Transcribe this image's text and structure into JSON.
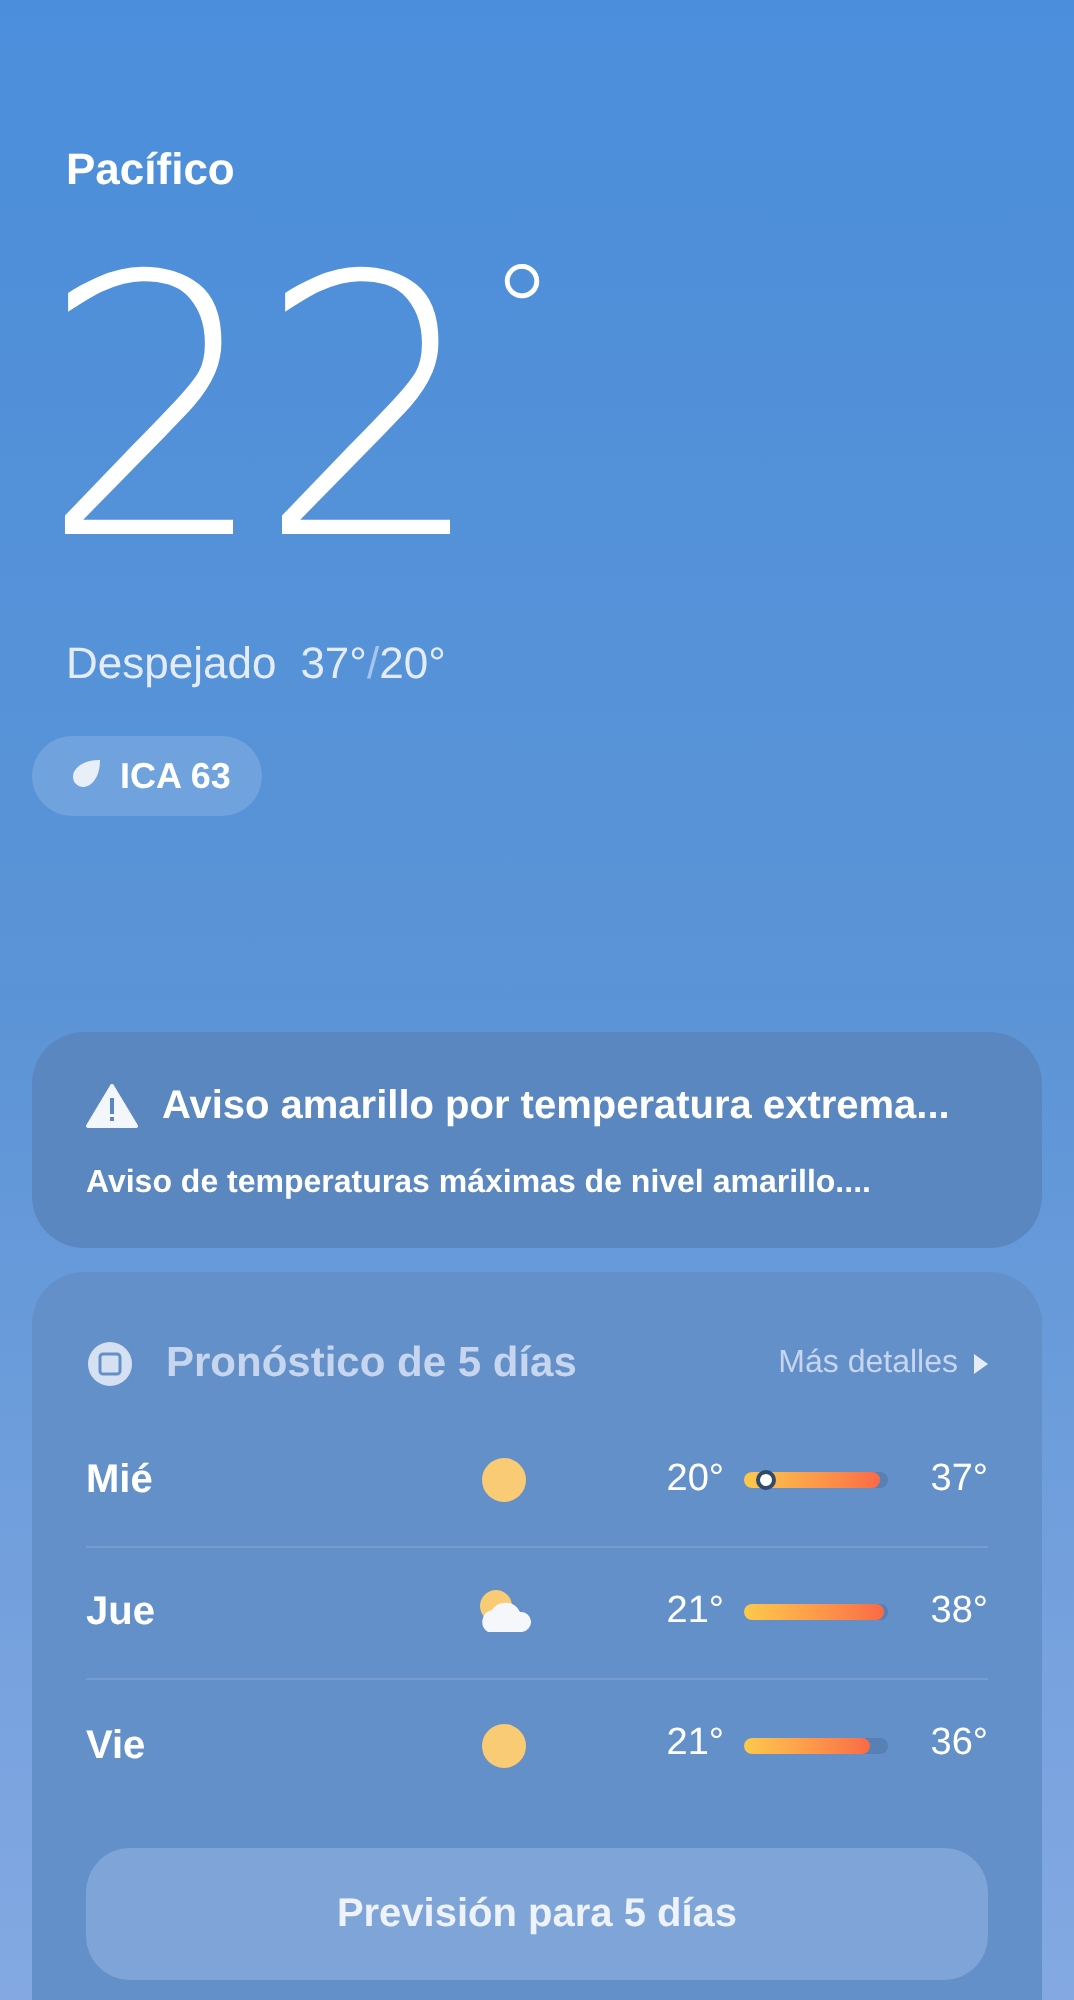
{
  "location": "Pacífico",
  "current": {
    "temperature": "22",
    "unit": "°",
    "condition": "Despejado",
    "high": "37°",
    "separator": "/",
    "low": "20°"
  },
  "aqi": {
    "label": "ICA 63"
  },
  "alert": {
    "title": "Aviso amarillo por temperatura extrema...",
    "text": "Aviso de temperaturas máximas de nivel amarillo...."
  },
  "forecast": {
    "title": "Pronóstico de 5 días",
    "more": "Más detalles",
    "button": "Previsión para 5 días",
    "days": [
      {
        "day": "Mié",
        "kind": "sun",
        "low": "20°",
        "high": "37°",
        "level": 0.95,
        "now": true
      },
      {
        "day": "Jue",
        "kind": "partly-cloudy",
        "low": "21°",
        "high": "38°",
        "level": 0.97,
        "now": false
      },
      {
        "day": "Vie",
        "kind": "sun",
        "low": "21°",
        "high": "36°",
        "level": 0.88,
        "now": false
      }
    ]
  }
}
